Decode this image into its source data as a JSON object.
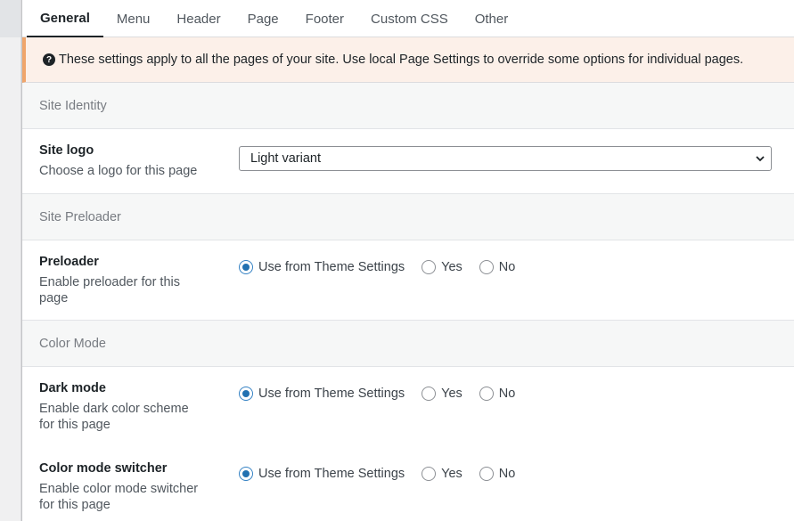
{
  "tabs": [
    {
      "label": "General",
      "active": true
    },
    {
      "label": "Menu"
    },
    {
      "label": "Header"
    },
    {
      "label": "Page"
    },
    {
      "label": "Footer"
    },
    {
      "label": "Custom CSS"
    },
    {
      "label": "Other"
    }
  ],
  "notice": {
    "icon": "question-circle-icon",
    "text": "These settings apply to all the pages of your site. Use local Page Settings to override some options for individual pages."
  },
  "sections": {
    "identity": {
      "title": "Site Identity",
      "logo": {
        "title": "Site logo",
        "description": "Choose a logo for this page",
        "selected": "Light variant"
      }
    },
    "preloader": {
      "title": "Site Preloader",
      "field": {
        "title": "Preloader",
        "description": "Enable preloader for this page",
        "options": [
          "Use from Theme Settings",
          "Yes",
          "No"
        ],
        "selected": "Use from Theme Settings"
      }
    },
    "color_mode": {
      "title": "Color Mode",
      "dark_mode": {
        "title": "Dark mode",
        "description": "Enable dark color scheme for this page",
        "options": [
          "Use from Theme Settings",
          "Yes",
          "No"
        ],
        "selected": "Use from Theme Settings"
      },
      "switcher": {
        "title": "Color mode switcher",
        "description": "Enable color mode switcher for this page",
        "options": [
          "Use from Theme Settings",
          "Yes",
          "No"
        ],
        "selected": "Use from Theme Settings"
      }
    }
  },
  "colors": {
    "accent": "#2271b1",
    "notice_bg": "#fcf0e9",
    "notice_border": "#f0a56b"
  }
}
